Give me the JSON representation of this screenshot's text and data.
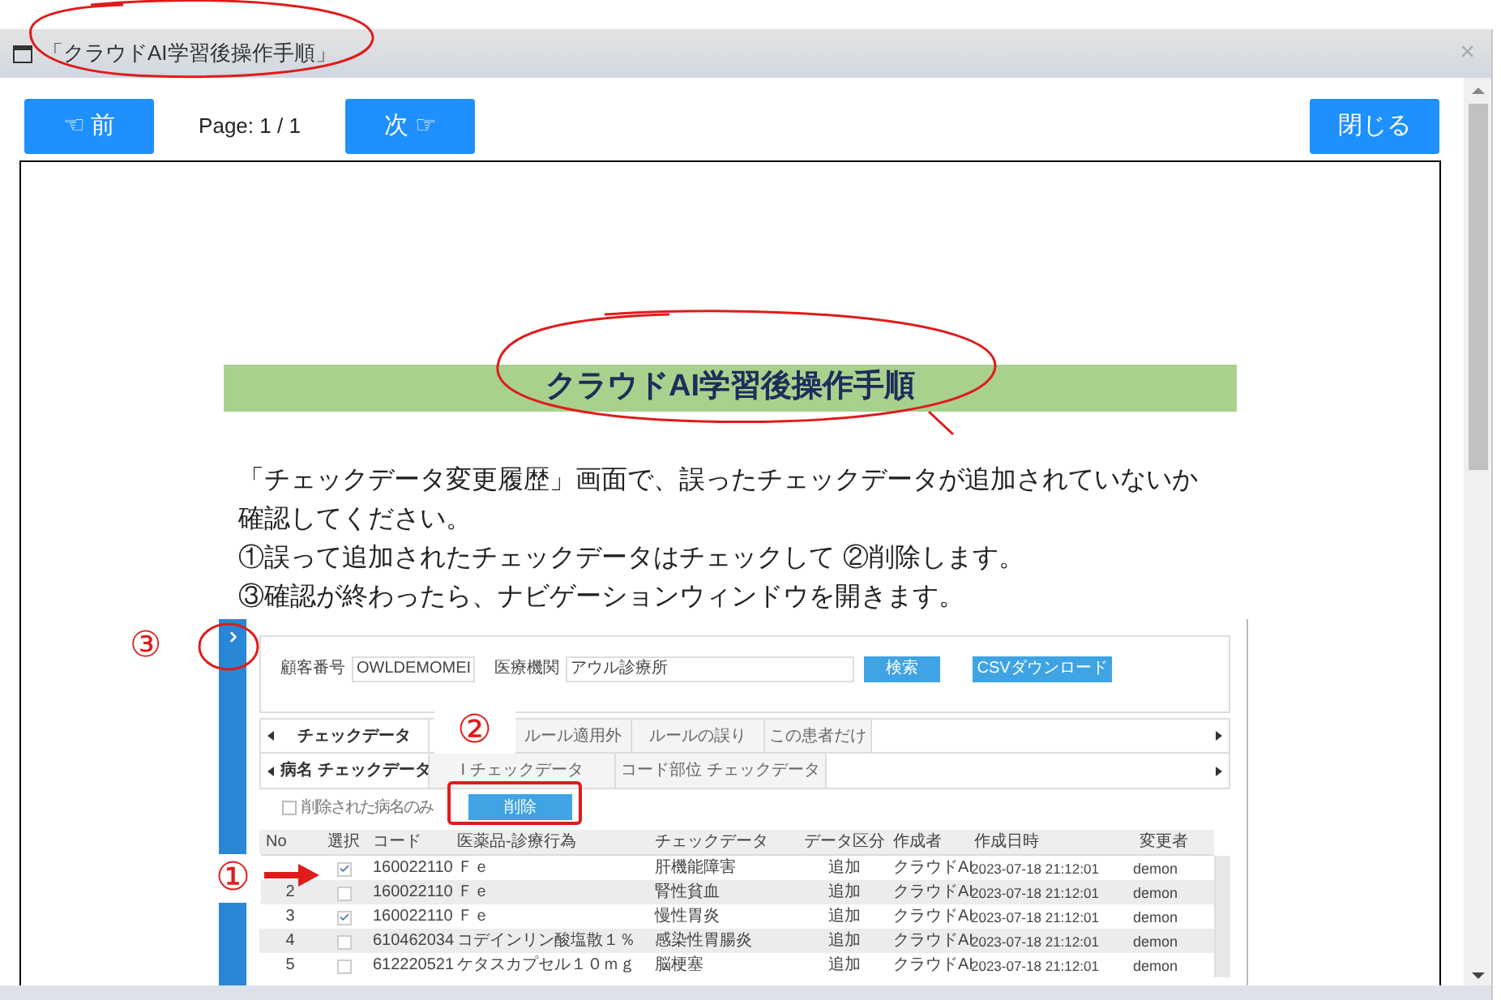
{
  "window": {
    "title": "「クラウドAI学習後操作手順」",
    "close": "×"
  },
  "toolbar": {
    "prev": {
      "icon": "☜",
      "label": "前"
    },
    "page": "Page: 1 / 1",
    "next": {
      "label": "次",
      "icon": "☞"
    },
    "close": "閉じる"
  },
  "document": {
    "heading": "クラウドAI学習後操作手順",
    "lines": [
      "「チェックデータ変更履歴」画面で、誤ったチェックデータが追加されていないか",
      "確認してください。",
      "①誤って追加されたチェックデータはチェックして ②削除します。",
      "③確認が終わったら、ナビゲーションウィンドウを開きます。"
    ],
    "screenshot": {
      "fields": [
        {
          "label": "顧客番号",
          "value": "OWLDEMOMEI"
        },
        {
          "label": "医療機関",
          "value": "アウル診療所"
        }
      ],
      "buttons": [
        "検索",
        "CSVダウンロード"
      ],
      "tab_rows": [
        {
          "tabs": [
            {
              "label": "チェックデータ",
              "selected": true
            },
            {
              "label": "ルール適用外",
              "selected": false
            },
            {
              "label": "ルールの誤り",
              "selected": false
            },
            {
              "label": "この患者だけ",
              "selected": false
            }
          ]
        },
        {
          "tabs": [
            {
              "label": "病名 チェックデータ",
              "selected": true
            },
            {
              "label": "I チェックデータ",
              "selected": false
            },
            {
              "label": "コード部位 チェックデータ",
              "selected": false
            }
          ]
        }
      ],
      "filter": {
        "label": "削除された病名のみ",
        "checked": false
      },
      "delete_button": "削除",
      "columns": [
        "No",
        "選択",
        "コード",
        "医薬品-診療行為",
        "チェックデータ",
        "データ区分",
        "作成者",
        "作成日時",
        "変更者"
      ],
      "rows": [
        {
          "selected": true,
          "code": "160022110",
          "item": "Ｆｅ",
          "check": "肝機能障害",
          "kind": "追加",
          "author": "クラウドAI",
          "created": "2023-07-18 21:12:01",
          "editor": "demon"
        },
        {
          "no": "2",
          "selected": false,
          "code": "160022110",
          "item": "Ｆｅ",
          "check": "腎性貧血",
          "kind": "追加",
          "author": "クラウドAI",
          "created": "2023-07-18 21:12:01",
          "editor": "demon"
        },
        {
          "no": "3",
          "selected": true,
          "code": "160022110",
          "item": "Ｆｅ",
          "check": "慢性胃炎",
          "kind": "追加",
          "author": "クラウドAI",
          "created": "2023-07-18 21:12:01",
          "editor": "demon"
        },
        {
          "no": "4",
          "selected": false,
          "code": "610462034",
          "item": "コデインリン酸塩散１％",
          "check": "感染性胃腸炎",
          "kind": "追加",
          "author": "クラウドAI",
          "created": "2023-07-18 21:12:01",
          "editor": "demon"
        },
        {
          "no": "5",
          "selected": false,
          "code": "612220521",
          "item": "ケタスカプセル１０ｍｇ",
          "check": "脳梗塞",
          "kind": "追加",
          "author": "クラウドAI",
          "created": "2023-07-18 21:12:01",
          "editor": "demon"
        }
      ]
    }
  },
  "markers": {
    "one": "①",
    "two": "②",
    "three": "③"
  }
}
